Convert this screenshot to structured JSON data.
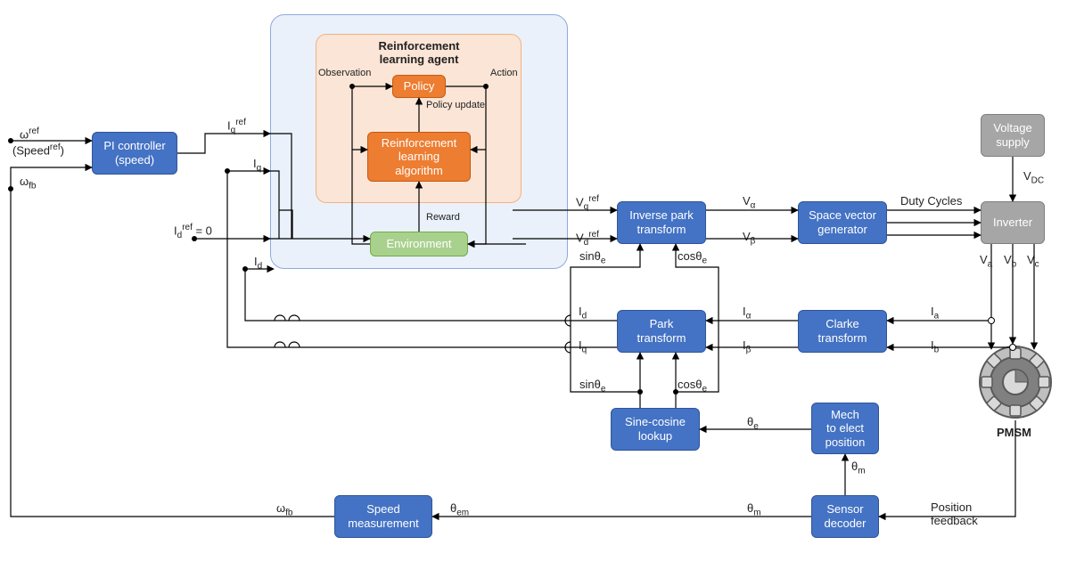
{
  "blocks": {
    "pi": "PI controller\n(speed)",
    "ipark": "Inverse park\ntransform",
    "svg": "Space vector\ngenerator",
    "vsupply": "Voltage\nsupply",
    "inverter": "Inverter",
    "park": "Park\ntransform",
    "clarke": "Clarke\ntransform",
    "sincos": "Sine-cosine\nlookup",
    "m2e": "Mech\nto elect\nposition",
    "sensor": "Sensor\ndecoder",
    "speed": "Speed\nmeasurement",
    "policy": "Policy",
    "rlalg": "Reinforcement\nlearning\nalgorithm",
    "env": "Environment",
    "rl_title": "Reinforcement\nlearning agent",
    "pmsm": "PMSM"
  },
  "labels": {
    "omega_ref": "ω<span class='sup'>ref</span>",
    "speed_ref": "(Speed<span class='sup'>ref</span>)",
    "omega_fb_left": "ω<span class='sub'>fb</span>",
    "iq_ref": "I<span class='sub'>q</span><span class='sup'>ref</span>",
    "iq": "I<span class='sub'>q</span>",
    "id_ref0": "I<span class='sub'>d</span><span class='sup'>ref</span> = 0",
    "id": "I<span class='sub'>d</span>",
    "vq_ref": "V<span class='sub'>q</span><span class='sup'>ref</span>",
    "vd_ref": "V<span class='sub'>d</span><span class='sup'>ref</span>",
    "sin_theta": "sinθ<span class='sub'>e</span>",
    "cos_theta": "cosθ<span class='sub'>e</span>",
    "valpha": "V<span class='sub'>α</span>",
    "vbeta": "V<span class='sub'>β</span>",
    "duty": "Duty Cycles",
    "vdc": "V<span class='sub'>DC</span>",
    "va": "V<span class='sub'>a</span>",
    "vb": "V<span class='sub'>b</span>",
    "vc": "V<span class='sub'>c</span>",
    "ialpha": "I<span class='sub'>α</span>",
    "ibeta": "I<span class='sub'>β</span>",
    "ia": "I<span class='sub'>a</span>",
    "ib": "I<span class='sub'>b</span>",
    "id2": "I<span class='sub'>d</span>",
    "iq2": "I<span class='sub'>q</span>",
    "theta_e": "θ<span class='sub'>e</span>",
    "theta_m": "θ<span class='sub'>m</span>",
    "theta_m2": "θ<span class='sub'>m</span>",
    "theta_em": "θ<span class='sub'>em</span>",
    "omega_fb2": "ω<span class='sub'>fb</span>",
    "posfb": "Position\nfeedback",
    "observation": "Observation",
    "action": "Action",
    "reward": "Reward",
    "policy_update": "Policy\nupdate"
  }
}
